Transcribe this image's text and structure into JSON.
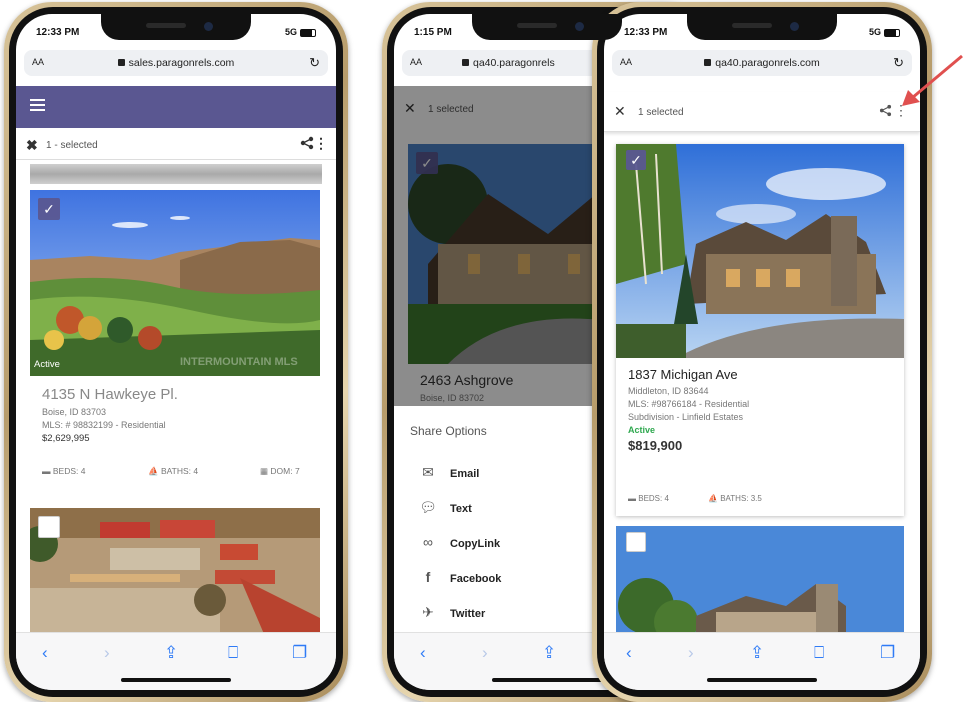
{
  "phone1": {
    "status": {
      "time": "12:33 PM",
      "signal": "5G"
    },
    "url": "sales.paragonrels.com",
    "aa": "AA",
    "selection": {
      "text": "1 - selected"
    },
    "listing": {
      "badge": "Active",
      "address": "4135 N Hawkeye Pl.",
      "city": "Boise, ID 83703",
      "mls": "MLS: # 98832199 - Residential",
      "price": "$2,629,995",
      "beds": "BEDS: 4",
      "baths": "BATHS: 4",
      "dom": "DOM: 7",
      "watermark": "INTERMOUNTAIN MLS"
    }
  },
  "phone2": {
    "status": {
      "time": "1:15 PM"
    },
    "url": "qa40.paragonrels",
    "aa": "AA",
    "selection": {
      "text": "1 selected"
    },
    "listing": {
      "address": "2463 Ashgrove",
      "city": "Boise, ID 83702"
    },
    "share": {
      "title": "Share Options",
      "options": [
        {
          "label": "Email",
          "icon": "email-icon"
        },
        {
          "label": "Text",
          "icon": "chat-icon"
        },
        {
          "label": "CopyLink",
          "icon": "link-icon"
        },
        {
          "label": "Facebook",
          "icon": "facebook-icon"
        },
        {
          "label": "Twitter",
          "icon": "twitter-icon"
        }
      ]
    }
  },
  "phone3": {
    "status": {
      "time": "12:33 PM",
      "signal": "5G"
    },
    "url": "qa40.paragonrels.com",
    "aa": "AA",
    "selection": {
      "text": "1 selected"
    },
    "listing": {
      "address": "1837 Michigan Ave",
      "city": "Middleton, ID 83644",
      "mls": "MLS: #98766184 - Residential",
      "subdivision": "Subdivision - Linfield Estates",
      "status": "Active",
      "price": "$819,900",
      "beds": "BEDS: 4",
      "baths": "BATHS: 3.5"
    }
  },
  "colors": {
    "header": "#5a5791",
    "active": "#2fa84f",
    "link": "#2f7bf6",
    "arrow": "#e0504f"
  }
}
